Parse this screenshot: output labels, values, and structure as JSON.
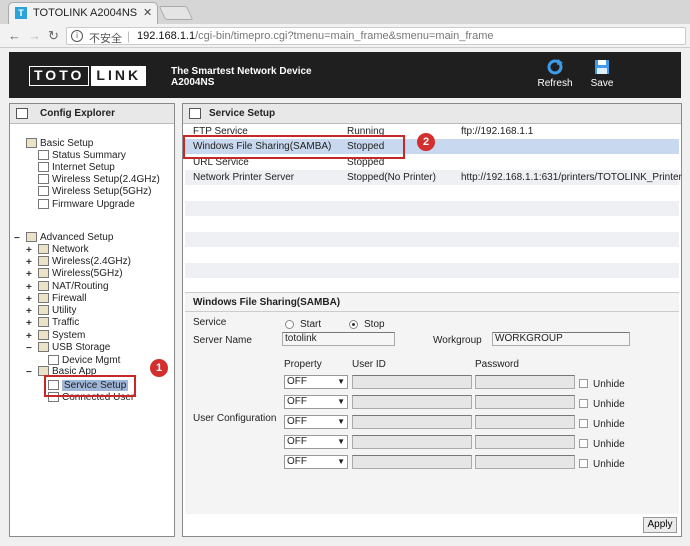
{
  "browser": {
    "tab_title": "TOTOLINK A2004NS",
    "tab_icon_letter": "T",
    "insecure_label": "不安全",
    "url_host": "192.168.1.1",
    "url_path": "/cgi-bin/timepro.cgi?tmenu=main_frame&smenu=main_frame"
  },
  "header": {
    "logo_left": "TOTO",
    "logo_right": "LINK",
    "tagline": "The Smartest Network Device",
    "model": "A2004NS",
    "refresh_label": "Refresh",
    "save_label": "Save"
  },
  "sidebar": {
    "title": "Config Explorer",
    "basic_setup": "Basic Setup",
    "basic_items": [
      "Status Summary",
      "Internet Setup",
      "Wireless Setup(2.4GHz)",
      "Wireless Setup(5GHz)",
      "Firmware Upgrade"
    ],
    "advanced_setup": "Advanced Setup",
    "advanced_items": [
      "Network",
      "Wireless(2.4GHz)",
      "Wireless(5GHz)",
      "NAT/Routing",
      "Firewall",
      "Utility",
      "Traffic",
      "System",
      "USB Storage"
    ],
    "usb_children": [
      "Device Mgmt"
    ],
    "basic_app": "Basic App",
    "basic_app_children": [
      "Service Setup",
      "Connected User"
    ]
  },
  "main": {
    "title": "Service Setup",
    "services": [
      {
        "name": "FTP Service",
        "status": "Running",
        "url": "ftp://192.168.1.1"
      },
      {
        "name": "Windows File Sharing(SAMBA)",
        "status": "Stopped",
        "url": ""
      },
      {
        "name": "URL Service",
        "status": "Stopped",
        "url": ""
      },
      {
        "name": "Network Printer Server",
        "status": "Stopped(No Printer)",
        "url": "http://192.168.1.1:631/printers/TOTOLINK_Printer"
      }
    ],
    "detail": {
      "title": "Windows File Sharing(SAMBA)",
      "service_label": "Service",
      "start_label": "Start",
      "stop_label": "Stop",
      "service_state": "stop",
      "server_name_label": "Server Name",
      "server_name_value": "totolink",
      "workgroup_label": "Workgroup",
      "workgroup_value": "WORKGROUP",
      "user_config_label": "User Configuration",
      "col_property": "Property",
      "col_user_id": "User ID",
      "col_password": "Password",
      "rows": [
        {
          "property": "OFF",
          "user_id": "",
          "password": "",
          "unhide": "Unhide"
        },
        {
          "property": "OFF",
          "user_id": "",
          "password": "",
          "unhide": "Unhide"
        },
        {
          "property": "OFF",
          "user_id": "",
          "password": "",
          "unhide": "Unhide"
        },
        {
          "property": "OFF",
          "user_id": "",
          "password": "",
          "unhide": "Unhide"
        },
        {
          "property": "OFF",
          "user_id": "",
          "password": "",
          "unhide": "Unhide"
        }
      ]
    },
    "apply_label": "Apply"
  },
  "callouts": {
    "badge_1": "1",
    "badge_2": "2",
    "color": "#d32f2f"
  }
}
